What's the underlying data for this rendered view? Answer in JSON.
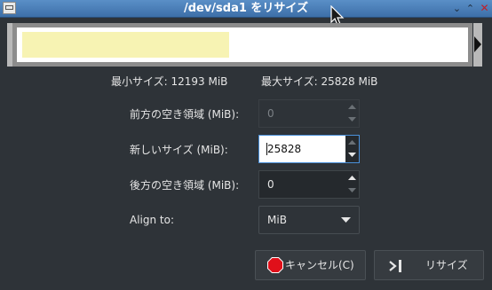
{
  "window": {
    "title": "/dev/sda1 をリサイズ",
    "minimize_symbol": "⌄",
    "maximize_symbol": "⌃",
    "close_symbol": "✕"
  },
  "partition_bar": {
    "used_fraction": 0.47,
    "used_color": "#f7f3b3"
  },
  "sizes": {
    "min_label": "最小サイズ: 12193 MiB",
    "max_label": "最大サイズ: 25828 MiB"
  },
  "fields": {
    "free_before": {
      "label": "前方の空き領域 (MiB):",
      "value": "0"
    },
    "new_size": {
      "label": "新しいサイズ (MiB):",
      "value": "25828"
    },
    "free_after": {
      "label": "後方の空き領域 (MiB):",
      "value": "0"
    },
    "align": {
      "label": "Align to:",
      "value": "MiB"
    }
  },
  "buttons": {
    "cancel": "キャンセル(C)",
    "resize": "リサイズ"
  },
  "icons": {
    "app": "app-window-icon",
    "cancel": "stop-icon",
    "resize": "resize-icon"
  },
  "colors": {
    "titlebar": "#4a7fb8",
    "background": "#2e3338",
    "focus": "#4a90d9",
    "stop": "#e0101a"
  }
}
